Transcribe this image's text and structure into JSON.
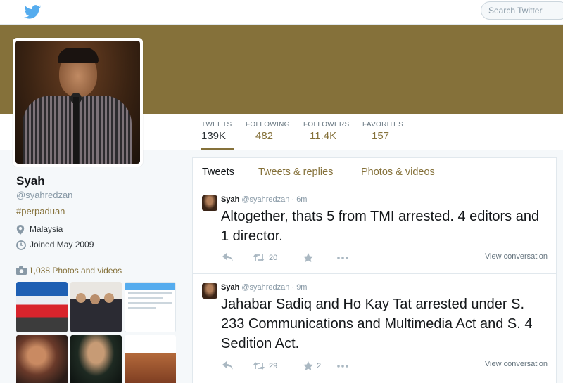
{
  "search": {
    "placeholder": "Search Twitter"
  },
  "colors": {
    "accent": "#85713a",
    "banner": "#85713a",
    "background": "#f5f8fa"
  },
  "icons": {
    "logo": "twitter-bird-icon",
    "location": "map-pin-icon",
    "joined": "clock-icon",
    "photos": "camera-icon",
    "reply": "reply-icon",
    "retweet": "retweet-icon",
    "favorite": "star-icon",
    "more": "more-dots-icon"
  },
  "stats": [
    {
      "label": "TWEETS",
      "value": "139K"
    },
    {
      "label": "FOLLOWING",
      "value": "482"
    },
    {
      "label": "FOLLOWERS",
      "value": "11.4K"
    },
    {
      "label": "FAVORITES",
      "value": "157"
    }
  ],
  "profile": {
    "name": "Syah",
    "handle": "@syahredzan",
    "bio": "#perpaduan",
    "location": "Malaysia",
    "joined": "Joined May 2009",
    "photos": "1,038 Photos and videos"
  },
  "tabs": [
    "Tweets",
    "Tweets & replies",
    "Photos & videos"
  ],
  "tweets": [
    {
      "name": "Syah",
      "handle": "@syahredzan",
      "time": "· 6m",
      "text": "Altogether, thats 5 from TMI arrested. 4 editors and 1 director.",
      "retweets": "20",
      "favorites": "",
      "view": "View conversation"
    },
    {
      "name": "Syah",
      "handle": "@syahredzan",
      "time": "· 9m",
      "text": "Jahabar Sadiq and Ho Kay Tat arrested under S. 233 Communications and Multimedia Act and S. 4 Sedition Act.",
      "retweets": "29",
      "favorites": "2",
      "view": "View conversation"
    }
  ]
}
